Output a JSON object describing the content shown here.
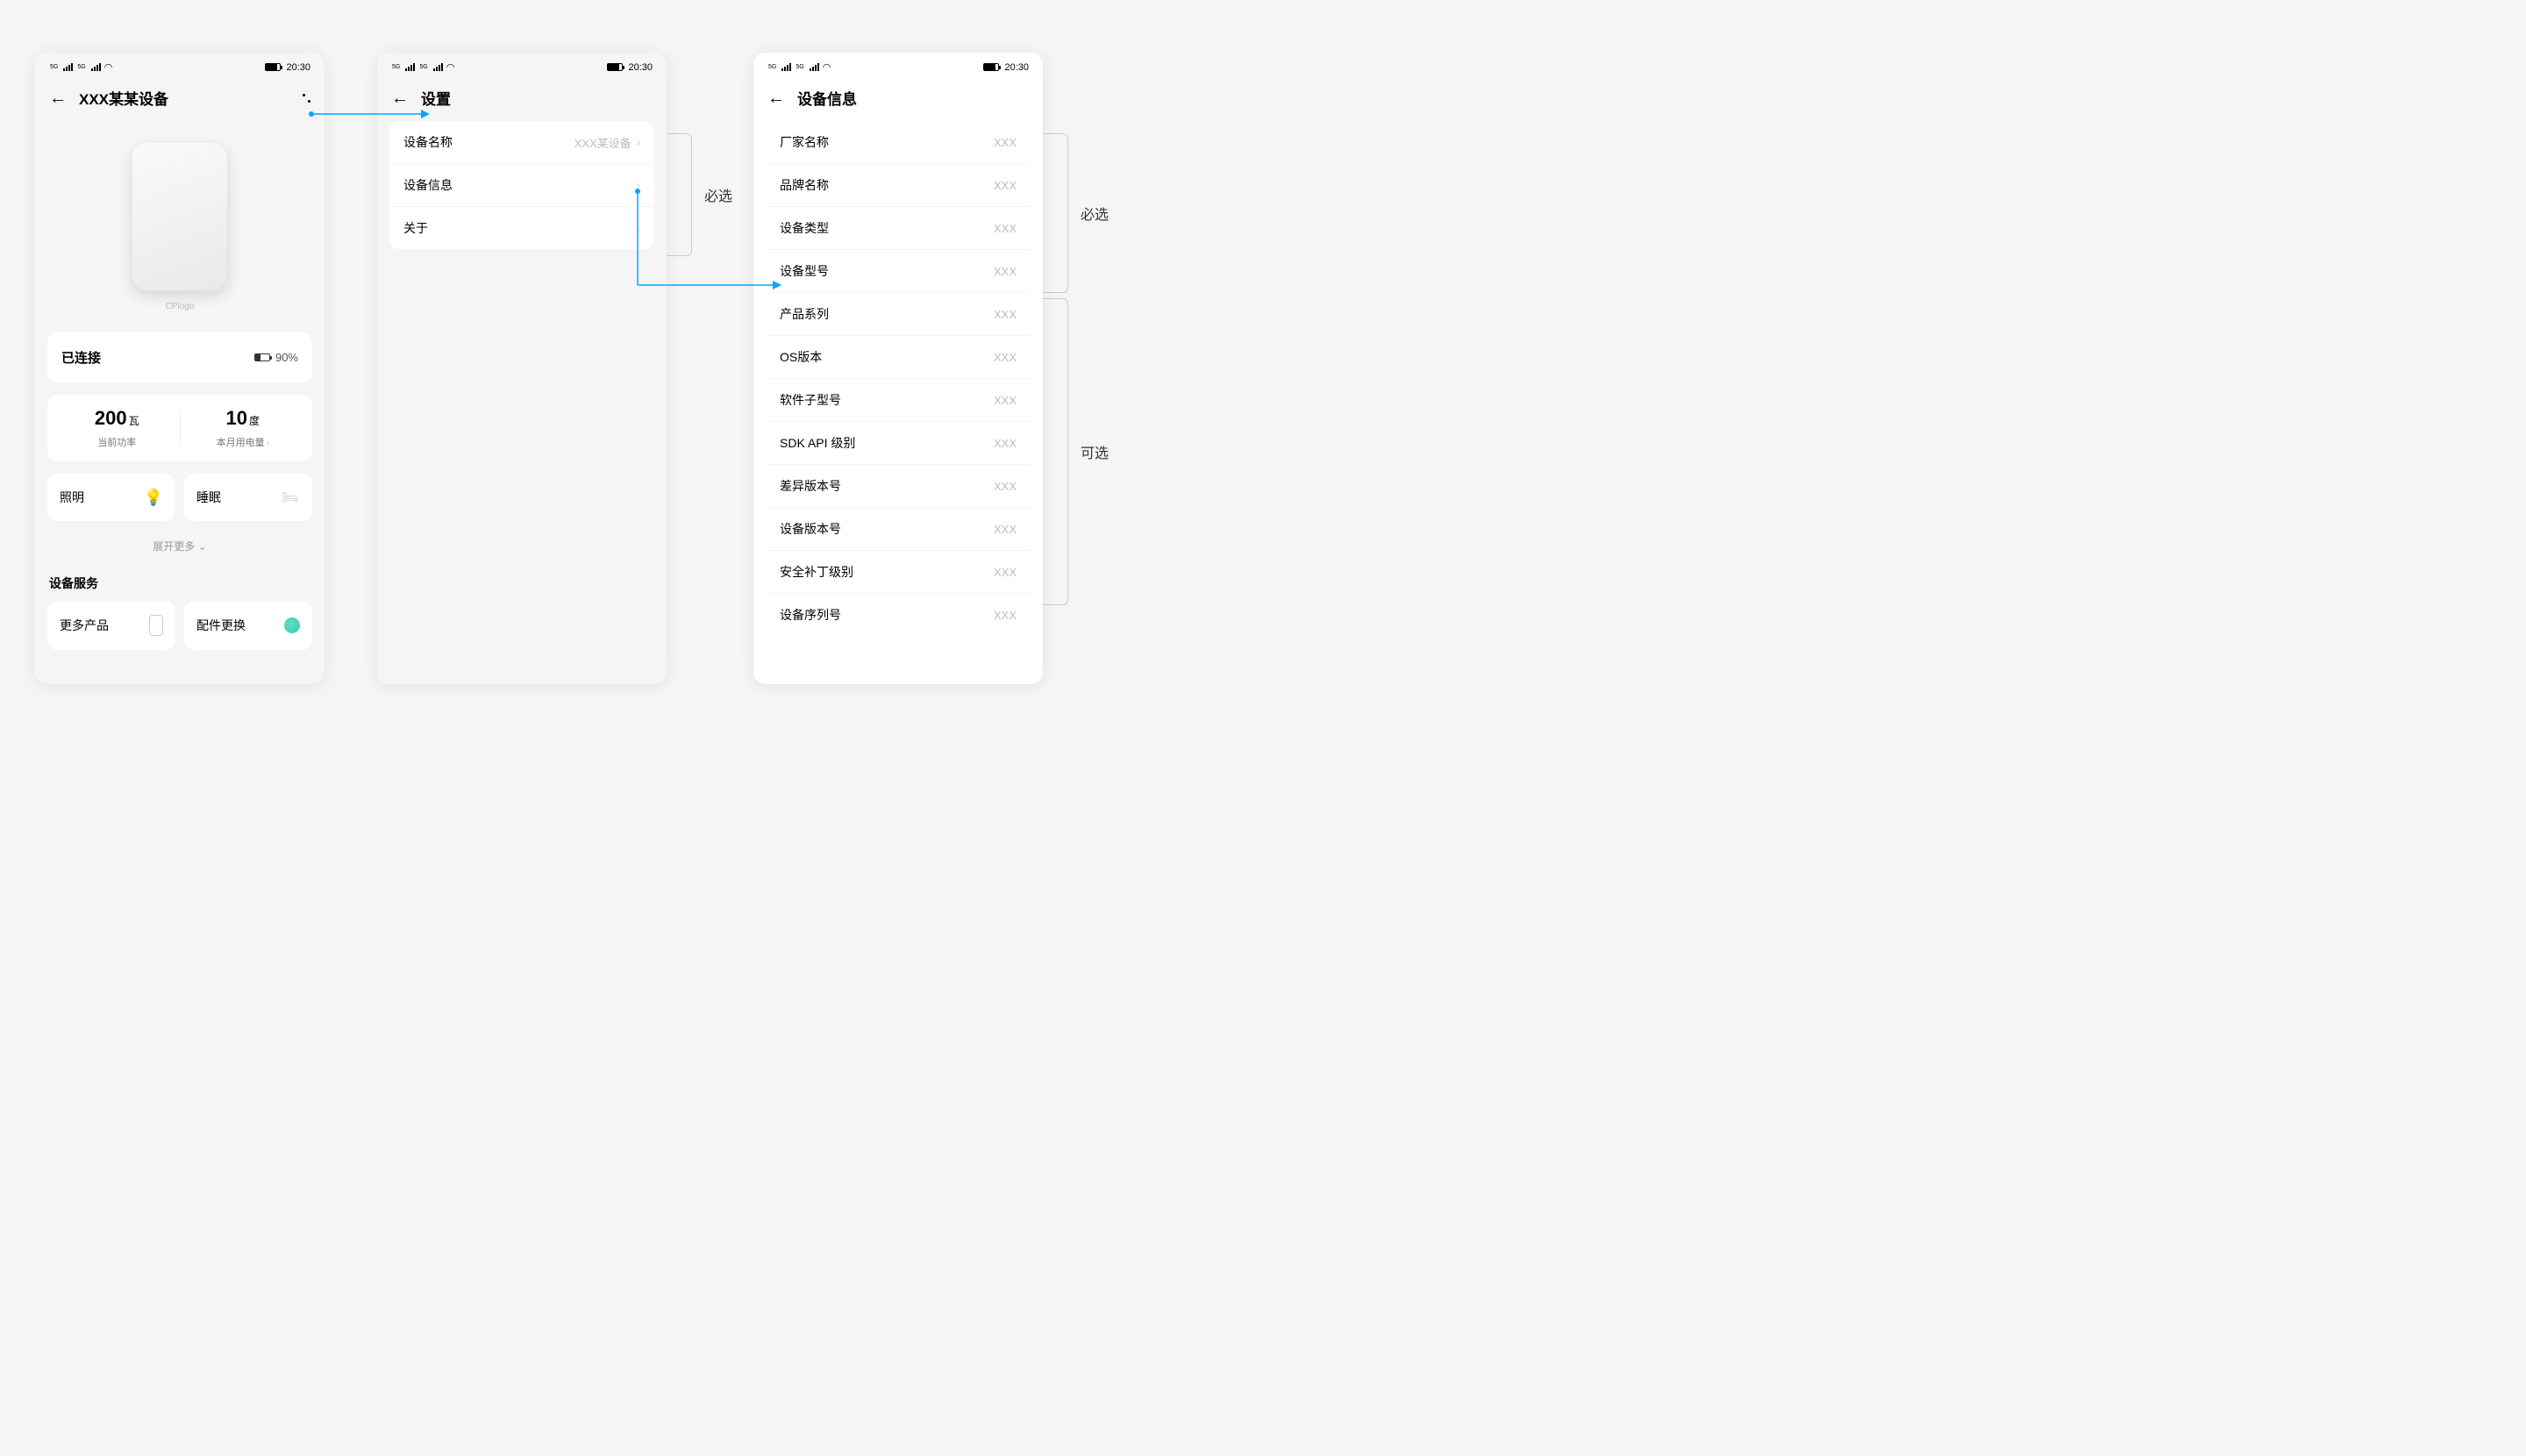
{
  "status": {
    "signal_label": "5G",
    "time": "20:30"
  },
  "screen1": {
    "title": "XXX某某设备",
    "cplogo": "CPlogo",
    "connected": "已连接",
    "battery_pct": "90%",
    "power_num": "200",
    "power_unit": "瓦",
    "power_sub": "当前功率",
    "usage_num": "10",
    "usage_unit": "度",
    "usage_sub": "本月用电量",
    "tile_light": "照明",
    "tile_sleep": "睡眠",
    "expand": "展开更多",
    "service_title": "设备服务",
    "tile_more_products": "更多产品",
    "tile_accessory": "配件更换"
  },
  "screen2": {
    "title": "设置",
    "rows": [
      {
        "label": "设备名称",
        "value": "XXX某设备"
      },
      {
        "label": "设备信息",
        "value": ""
      },
      {
        "label": "关于",
        "value": ""
      }
    ],
    "bracket_required": "必选"
  },
  "screen3": {
    "title": "设备信息",
    "rows": [
      {
        "label": "厂家名称",
        "value": "XXX"
      },
      {
        "label": "品牌名称",
        "value": "XXX"
      },
      {
        "label": "设备类型",
        "value": "XXX"
      },
      {
        "label": "设备型号",
        "value": "XXX"
      },
      {
        "label": "产品系列",
        "value": "XXX"
      },
      {
        "label": "OS版本",
        "value": "XXX"
      },
      {
        "label": "软件子型号",
        "value": "XXX"
      },
      {
        "label": "SDK API 级别",
        "value": "XXX"
      },
      {
        "label": "差异版本号",
        "value": "XXX"
      },
      {
        "label": "设备版本号",
        "value": "XXX"
      },
      {
        "label": "安全补丁级别",
        "value": "XXX"
      },
      {
        "label": "设备序列号",
        "value": "XXX"
      }
    ],
    "bracket_required": "必选",
    "bracket_optional": "可选"
  }
}
